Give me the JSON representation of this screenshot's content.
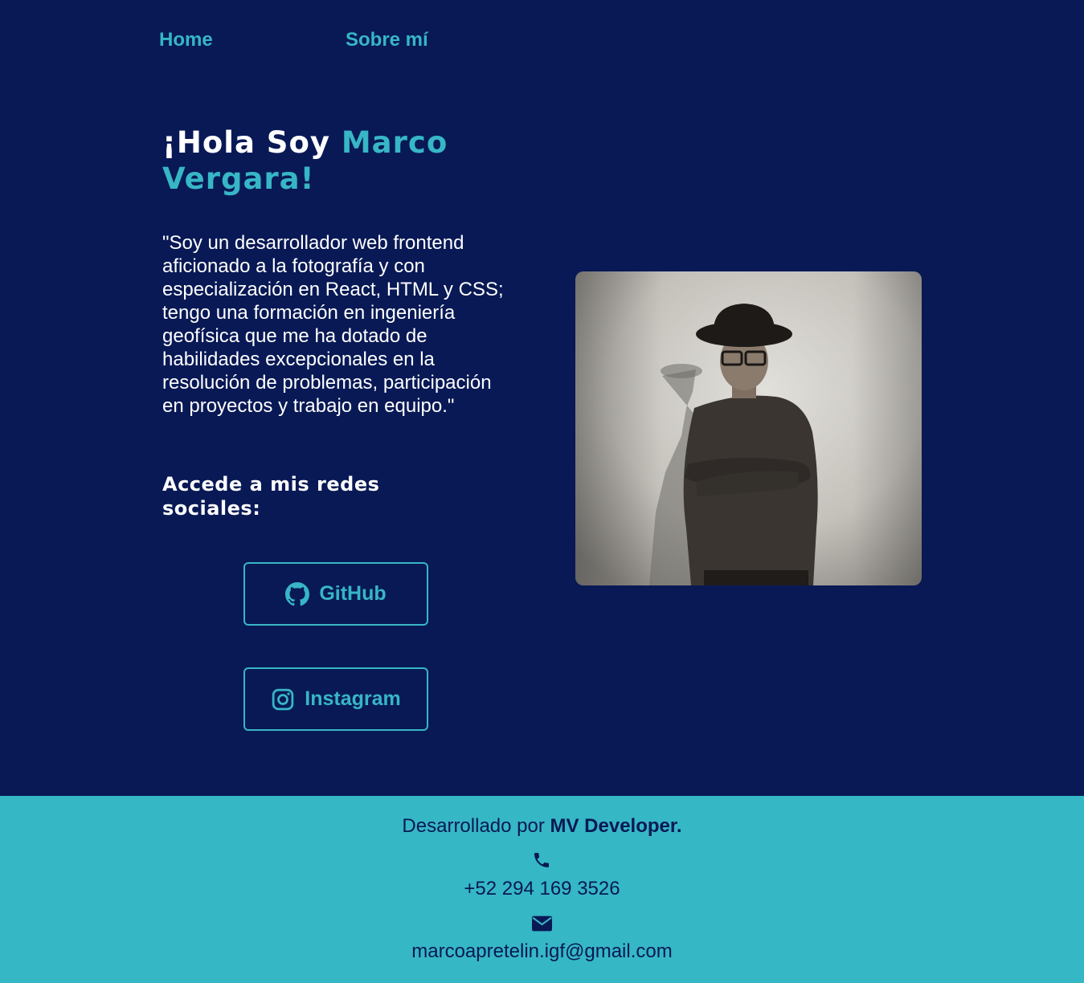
{
  "nav": {
    "home_label": "Home",
    "about_label": "Sobre mí"
  },
  "hero": {
    "greeting": "¡Hola Soy ",
    "name": "Marco Vergara!",
    "bio": "\"Soy un desarrollador web frontend aficionado a la fotografía y con especialización en React, HTML y CSS; tengo una formación en ingeniería geofísica que me ha dotado de habilidades excepcionales en la resolución de problemas, participación en proyectos y trabajo en equipo.\"",
    "social_heading": "Accede a mis redes sociales:"
  },
  "social": {
    "github_label": "GitHub",
    "github_icon": "github-icon",
    "instagram_label": "Instagram",
    "instagram_icon": "instagram-icon"
  },
  "photo": {
    "alt": "Marco Vergara"
  },
  "footer": {
    "credit_prefix": "Desarrollado por ",
    "credit_name": "MV Developer.",
    "phone_icon": "phone-icon",
    "phone": "+52 294 169 3526",
    "mail_icon": "mail-icon",
    "email": "marcoapretelin.igf@gmail.com"
  },
  "colors": {
    "background": "#081955",
    "accent": "#37b6c6",
    "footer_background": "#36b7c5",
    "footer_text": "#081955"
  }
}
